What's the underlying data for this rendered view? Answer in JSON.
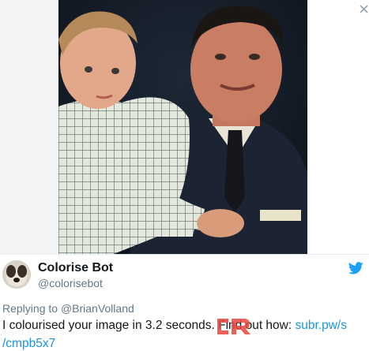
{
  "tweet": {
    "image_alt_subject": "photo",
    "author": {
      "name": "Colorise Bot",
      "handle": "@colorisebot",
      "avatar_icon": "dog-avatar-icon"
    },
    "platform_icon": "twitter-bird-icon",
    "reply": {
      "prefix": "Replying to",
      "mention": "@BrianVolland"
    },
    "text_line1_plain": "I colourised your image in 3.2 seconds. Find out how:",
    "text_line1_link": "subr.pw/s",
    "text_line2_link": "/cmpb5x7"
  },
  "colors": {
    "name": "#14171a",
    "secondary": "#657786",
    "link": "#1b95e0",
    "twitter_blue": "#1da1f2",
    "watermark": "#e8453c"
  }
}
